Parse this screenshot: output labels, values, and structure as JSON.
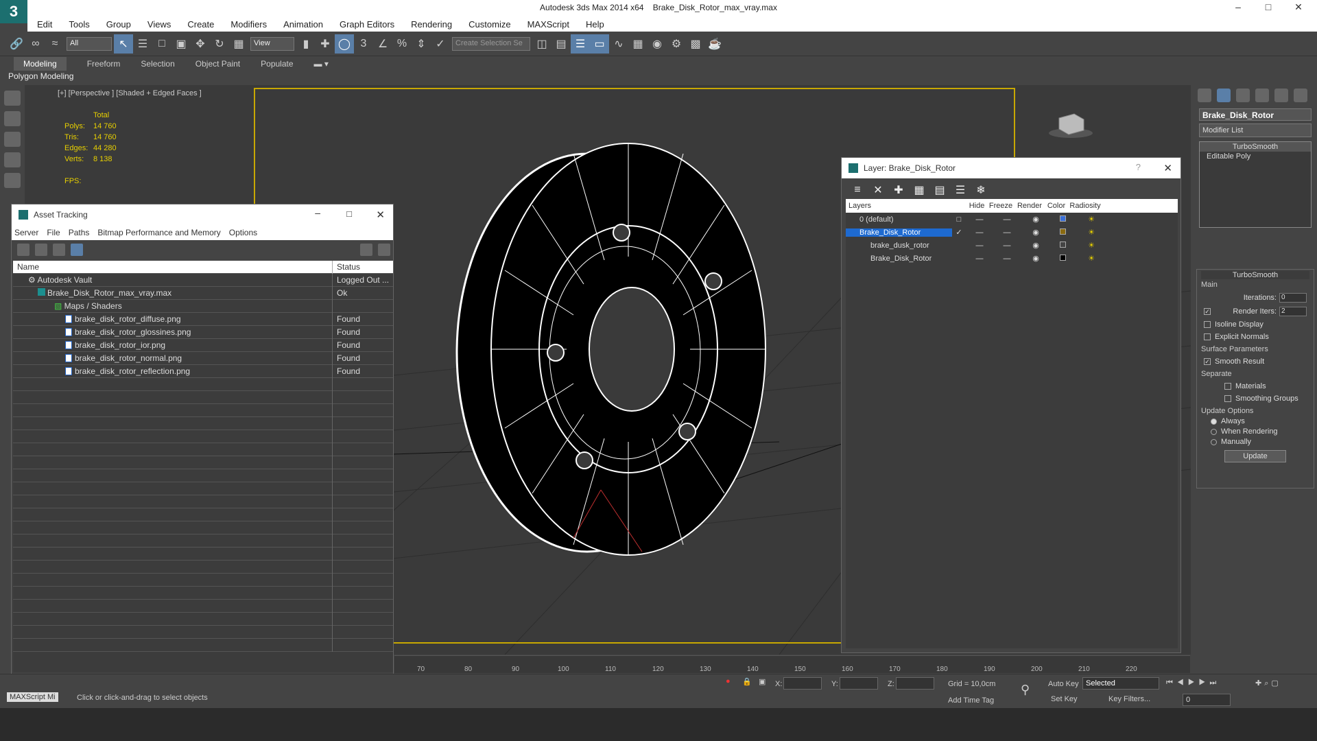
{
  "window": {
    "app": "Autodesk 3ds Max  2014 x64",
    "file": "Brake_Disk_Rotor_max_vray.max",
    "logo": "3"
  },
  "menu": [
    "Edit",
    "Tools",
    "Group",
    "Views",
    "Create",
    "Modifiers",
    "Animation",
    "Graph Editors",
    "Rendering",
    "Customize",
    "MAXScript",
    "Help"
  ],
  "toolbar": {
    "filter": "All",
    "refcoord": "View",
    "selection_set_placeholder": "Create Selection Se"
  },
  "ribbon": {
    "tabs": [
      "Modeling",
      "Freeform",
      "Selection",
      "Object Paint",
      "Populate"
    ],
    "sub": "Polygon Modeling"
  },
  "viewport": {
    "label": "[+] [Perspective ] [Shaded + Edged Faces ]",
    "stats": {
      "header": "Total",
      "polys": "14 760",
      "tris": "14 760",
      "edges": "44 280",
      "verts": "8 138",
      "fps_label": "FPS:"
    },
    "stat_labels": {
      "polys": "Polys:",
      "tris": "Tris:",
      "edges": "Edges:",
      "verts": "Verts:"
    }
  },
  "asset_tracking": {
    "title": "Asset Tracking",
    "menu": [
      "Server",
      "File",
      "Paths",
      "Bitmap Performance and Memory",
      "Options"
    ],
    "columns": {
      "name": "Name",
      "status": "Status"
    },
    "rows": [
      {
        "name": "Autodesk Vault",
        "status": "Logged Out ..."
      },
      {
        "name": "Brake_Disk_Rotor_max_vray.max",
        "status": "Ok"
      },
      {
        "name": "Maps / Shaders",
        "status": ""
      },
      {
        "name": "brake_disk_rotor_diffuse.png",
        "status": "Found"
      },
      {
        "name": "brake_disk_rotor_glossines.png",
        "status": "Found"
      },
      {
        "name": "brake_disk_rotor_ior.png",
        "status": "Found"
      },
      {
        "name": "brake_disk_rotor_normal.png",
        "status": "Found"
      },
      {
        "name": "brake_disk_rotor_reflection.png",
        "status": "Found"
      }
    ]
  },
  "layer_dialog": {
    "title": "Layer: Brake_Disk_Rotor",
    "help": "?",
    "columns": [
      "Layers",
      "Hide",
      "Freeze",
      "Render",
      "Color",
      "Radiosity"
    ],
    "rows": [
      {
        "name": "0 (default)",
        "color": "#3a6fd8"
      },
      {
        "name": "Brake_Disk_Rotor",
        "color": "#8a6a10"
      },
      {
        "name": "brake_dusk_rotor",
        "color": "#444444"
      },
      {
        "name": "Brake_Disk_Rotor",
        "color": "#000000"
      }
    ]
  },
  "command_panel": {
    "object_name": "Brake_Disk_Rotor",
    "modifier_list": "Modifier List",
    "stack": [
      "TurboSmooth",
      "Editable Poly"
    ],
    "rollout_title": "TurboSmooth",
    "main": "Main",
    "iterations_label": "Iterations:",
    "iterations": "0",
    "render_iters_label": "Render Iters:",
    "render_iters": "2",
    "isoline": "Isoline Display",
    "explicit": "Explicit Normals",
    "surface": "Surface Parameters",
    "smooth_result": "Smooth Result",
    "separate": "Separate",
    "materials": "Materials",
    "smoothing_groups": "Smoothing Groups",
    "update_options": "Update Options",
    "always": "Always",
    "when_rendering": "When Rendering",
    "manually": "Manually",
    "update": "Update"
  },
  "timeline": {
    "ticks": [
      "70",
      "80",
      "90",
      "100",
      "110",
      "120",
      "130",
      "140",
      "150",
      "160",
      "170",
      "180",
      "190",
      "200",
      "210",
      "220"
    ]
  },
  "status": {
    "script": "MAXScript Mi",
    "prompt": "Click or click-and-drag to select objects",
    "x": "X:",
    "y": "Y:",
    "z": "Z:",
    "grid": "Grid = 10,0cm",
    "add_time_tag": "Add Time Tag",
    "auto_key": "Auto Key",
    "set_key": "Set Key",
    "selected": "Selected",
    "key_filters": "Key Filters...",
    "frame": "0"
  }
}
